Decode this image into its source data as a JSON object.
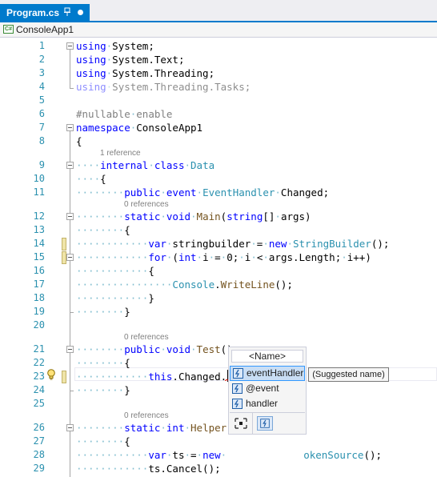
{
  "tab": {
    "title": "Program.cs"
  },
  "navbar": {
    "project": "ConsoleApp1",
    "project_icon": "C#"
  },
  "colors": {
    "accent": "#007acc",
    "keyword": "#0000ff",
    "type": "#2b91af",
    "line_number": "#2b91af",
    "codelens": "#808080"
  },
  "line_numbers": [
    "1",
    "2",
    "3",
    "4",
    "5",
    "6",
    "7",
    "8",
    "9",
    "10",
    "11",
    "12",
    "13",
    "14",
    "15",
    "16",
    "17",
    "18",
    "19",
    "20",
    "21",
    "22",
    "23",
    "24",
    "25",
    "26",
    "27",
    "28",
    "29"
  ],
  "codelens": {
    "line9": "1 reference",
    "line12": "0 references",
    "line21": "0 references",
    "line26": "0 references"
  },
  "code": {
    "l1": {
      "kw": "using",
      "ns": "System;"
    },
    "l2": {
      "kw": "using",
      "ns": "System.Text;"
    },
    "l3": {
      "kw": "using",
      "ns": "System.Threading;"
    },
    "l4": {
      "kw": "using",
      "ns": "System.Threading.Tasks;"
    },
    "l6": {
      "pp": "#nullable",
      "arg": "enable"
    },
    "l7": {
      "kw": "namespace",
      "name": "ConsoleApp1"
    },
    "l8": {
      "text": "{"
    },
    "l9": {
      "kw1": "internal",
      "kw2": "class",
      "type": "Data"
    },
    "l10": {
      "text": "{"
    },
    "l11": {
      "kw1": "public",
      "kw2": "event",
      "type": "EventHandler",
      "name": "Changed;"
    },
    "l12": {
      "kw1": "static",
      "kw2": "void",
      "method": "Main",
      "p1": "(",
      "kw3": "string",
      "p2": "[]",
      "p3": "args)"
    },
    "l13": {
      "text": "{"
    },
    "l14": {
      "kw": "var",
      "name": "stringbuilder",
      "op": "=",
      "kw2": "new",
      "type": "StringBuilder",
      "end": "();"
    },
    "l15": {
      "kw": "for",
      "p1": "(",
      "kw2": "int",
      "v1": "i",
      "op1": "=",
      "n": "0;",
      "v2": "i",
      "op2": "<",
      "e2": "args.Length;",
      "e3": "i++)"
    },
    "l16": {
      "text": "{"
    },
    "l17": {
      "type": "Console",
      "dot": ".",
      "method": "WriteLine",
      "end": "();"
    },
    "l18": {
      "text": "}"
    },
    "l19": {
      "text": "}"
    },
    "l21": {
      "kw1": "public",
      "kw2": "void",
      "method": "Test",
      "end": "()"
    },
    "l22": {
      "text": "{"
    },
    "l23": {
      "kw": "this",
      "rest": ".Changed."
    },
    "l24": {
      "text": "}"
    },
    "l26": {
      "kw1": "static",
      "kw2": "int",
      "method": "Helper"
    },
    "l27": {
      "text": "{"
    },
    "l28": {
      "kw": "var",
      "name": "ts",
      "op": "=",
      "kw2": "new",
      "type_tail": "okenSource",
      "end": "();"
    },
    "l29": {
      "text": "ts.Cancel();"
    }
  },
  "completion": {
    "header": "<Name>",
    "items": [
      {
        "label": "eventHandler",
        "icon": "event-icon",
        "selected": true
      },
      {
        "label": "@event",
        "icon": "event-icon",
        "selected": false
      },
      {
        "label": "handler",
        "icon": "event-icon",
        "selected": false
      }
    ],
    "filters": [
      "snippet-filter-icon",
      "event-filter-icon"
    ]
  },
  "tooltip": {
    "text": "(Suggested name)"
  }
}
